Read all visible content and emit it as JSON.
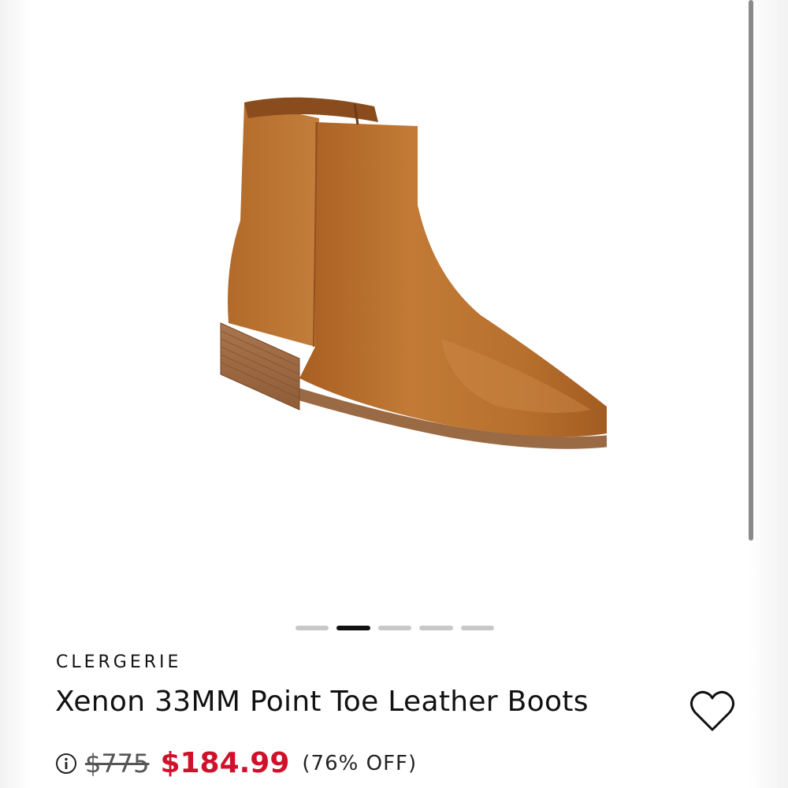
{
  "product": {
    "brand": "CLERGERIE",
    "title": "Xenon 33MM Point Toe Leather Boots",
    "original_price": "$775",
    "sale_price": "$184.99",
    "discount": "(76% OFF)",
    "image_alt": "tan-leather-ankle-boot"
  },
  "gallery": {
    "count": 5,
    "active_index": 1
  },
  "icons": {
    "wishlist": "heart-outline-icon",
    "price_info": "info-circle-icon"
  },
  "colors": {
    "sale_price": "#d0112b",
    "text": "#111111",
    "inactive_dot": "#c8c8c8",
    "active_dot": "#111111"
  }
}
